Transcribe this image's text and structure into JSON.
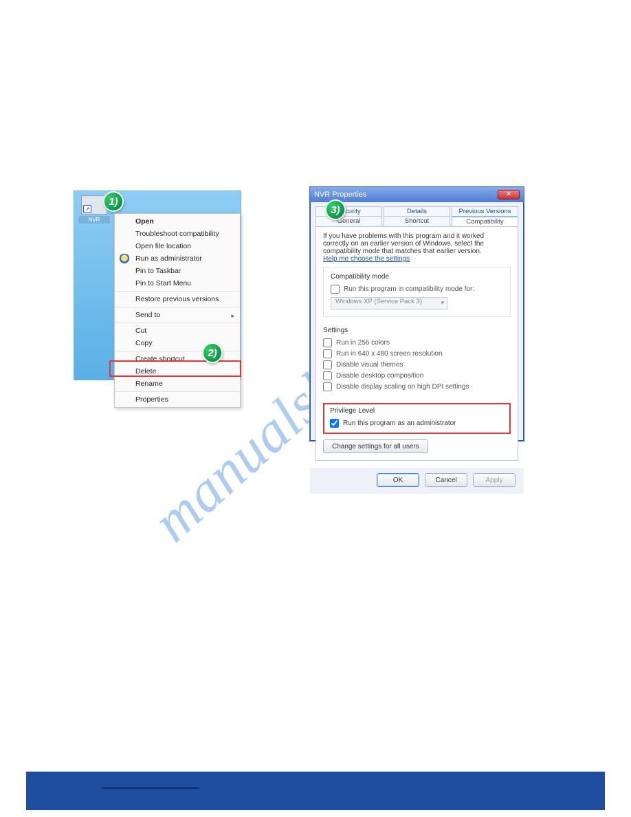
{
  "watermark": "manualshive.com",
  "badges": {
    "b1": "1)",
    "b2": "2)",
    "b3": "3)"
  },
  "desktop": {
    "icon_label": "NVR",
    "shortcut_arrow": "↗"
  },
  "ctxmenu": {
    "open": "Open",
    "troubleshoot": "Troubleshoot compatibility",
    "open_loc": "Open file location",
    "run_admin": "Run as administrator",
    "pin_taskbar": "Pin to Taskbar",
    "pin_start": "Pin to Start Menu",
    "restore": "Restore previous versions",
    "send_to": "Send to",
    "sub_arrow": "▸",
    "cut": "Cut",
    "copy": "Copy",
    "create_shortcut": "Create shortcut",
    "delete": "Delete",
    "rename": "Rename",
    "properties": "Properties"
  },
  "dialog": {
    "title": "NVR Properties",
    "close_glyph": "✕",
    "tabs_row1": [
      "Security",
      "Details",
      "Previous Versions"
    ],
    "tabs_row2": [
      "General",
      "Shortcut",
      "Compatibility"
    ],
    "active_tab": "Compatibility",
    "compat_intro": "If you have problems with this program and it worked correctly on an earlier version of Windows, select the compatibility mode that matches that earlier version.",
    "help_link": "Help me choose the settings",
    "compat_mode": {
      "group_title": "Compatibility mode",
      "chk_label": "Run this program in compatibility mode for:",
      "combo_value": "Windows XP (Service Pack 3)"
    },
    "settings": {
      "group_title": "Settings",
      "chk_256": "Run in 256 colors",
      "chk_640": "Run in 640 x 480 screen resolution",
      "chk_themes": "Disable visual themes",
      "chk_comp": "Disable desktop composition",
      "chk_dpi": "Disable display scaling on high DPI settings"
    },
    "privilege": {
      "group_title": "Privilege Level",
      "chk_admin": "Run this program as an administrator"
    },
    "change_all": "Change settings for all users",
    "buttons": {
      "ok": "OK",
      "cancel": "Cancel",
      "apply": "Apply"
    }
  }
}
